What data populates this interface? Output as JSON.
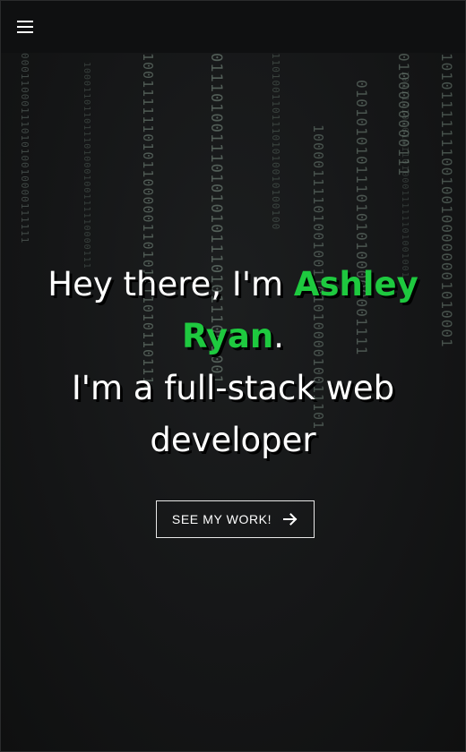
{
  "nav": {
    "menu_icon": "hamburger-menu-icon"
  },
  "hero": {
    "line1_prefix": "Hey there, I'm ",
    "name": "Ashley Ryan",
    "line1_suffix": ".",
    "line2": "I'm a full-stack web developer",
    "cta_label": "SEE MY WORK!",
    "cta_icon": "arrow-right-icon"
  },
  "colors": {
    "background": "#151617",
    "navbar": "#0f1011",
    "accent": "#1ec93f",
    "text": "#ffffff"
  },
  "background_code": [
    "0001100011101010010000111111",
    "100011011011101000100111110000111",
    "10011111101011000001101011110101101110",
    "011101001110101010111010111001001",
    "11010011011101010010100100",
    "1000011110100100110101000010011101",
    "01010101011101010100000001111",
    "101111101010110100011111101001001",
    "0100000000111",
    "1010111111100100100000001010001"
  ]
}
